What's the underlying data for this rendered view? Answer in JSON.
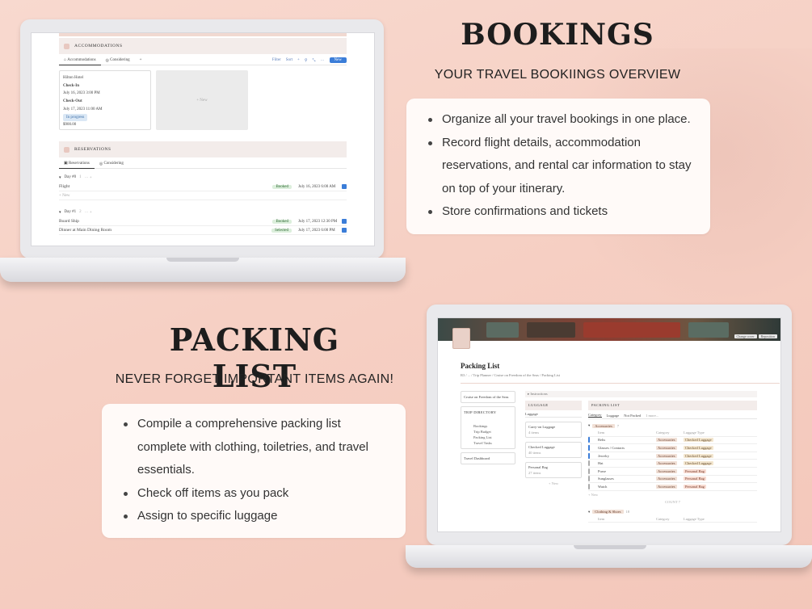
{
  "bookings": {
    "title": "BOOKINGS",
    "subtitle": "YOUR TRAVEL BOOKIINGS OVERVIEW",
    "bullets": [
      "Organize all your travel bookings in one place.",
      "Record flight details, accommodation",
      "reservations, and rental car information to stay",
      "on top of your itinerary.",
      "Store confirmations and tickets"
    ]
  },
  "packing": {
    "title": "PACKING LIST",
    "subtitle": "NEVER FORGET IMPORTANT ITEMS AGAIN!",
    "bullets": [
      "Compile a comprehensive packing list",
      "complete with clothing, toiletries, and travel",
      "essentials.",
      "Check off items as you pack",
      "Assign to specific luggage"
    ]
  },
  "screen1": {
    "accommodations": "ACCOMMODATIONS",
    "tabs": [
      "Accommodations",
      "Considering",
      "+"
    ],
    "tools": [
      "Filter",
      "Sort",
      "+",
      "⚲",
      "⤡",
      "⋯"
    ],
    "new_button": "New",
    "hotel_card": {
      "name": "Hilton Hotel",
      "checkin_label": "Check-In",
      "checkin": "July 16, 2023 3:00 PM",
      "checkout_label": "Check-Out",
      "checkout": "July 17, 2023 11:00 AM",
      "status": "In progress",
      "price": "$900.00"
    },
    "new_card": "+ New",
    "reservations": "RESERVATIONS",
    "res_tabs": [
      "Reservations",
      "Considering"
    ],
    "day0": {
      "label": "Day #0",
      "count": "1"
    },
    "day0_rows": [
      {
        "name": "Flight",
        "status": "Booked",
        "date": "July 16, 2023 6:00 AM"
      }
    ],
    "new_row": "+ New",
    "day1": {
      "label": "Day #1",
      "count": "2"
    },
    "day1_rows": [
      {
        "name": "Board Ship",
        "status": "Booked",
        "date": "July 17, 2023 12:30 PM"
      },
      {
        "name": "Dinner at Main Dining Room",
        "status": "Selected",
        "date": "July 17, 2023 6:00 PM"
      }
    ]
  },
  "screen2": {
    "banner_buttons": [
      "Change cover",
      "Reposition"
    ],
    "page_title": "Packing List",
    "breadcrumb": "R3 / ... / Trip Planner / Cruise on Freedom of the Seas / Packing List",
    "left": {
      "cruise": "Cruise on Freedom of the Seas",
      "trip_dir": "TRIP DIRECTORY",
      "dir_items": [
        "Bookings",
        "Trip Budget",
        "Packing List",
        "Travel Tasks"
      ],
      "dashboard": "Travel Dashboard"
    },
    "instructions": "Instructions",
    "luggage": {
      "header": "LUGGAGE",
      "tab": "Luggage",
      "items": [
        {
          "name": "Carry-on Luggage",
          "count": "4 items"
        },
        {
          "name": "Checked Luggage",
          "count": "40 items"
        },
        {
          "name": "Personal Bag",
          "count": "27 items"
        }
      ],
      "new": "+ New"
    },
    "packing": {
      "header": "PACKING LIST",
      "tabs": [
        "Category",
        "Luggage",
        "Not Packed",
        "1 more..."
      ],
      "group1": "Accessories",
      "group1_count": "7",
      "columns": [
        "Item",
        "Category",
        "Luggage Type"
      ],
      "rows": [
        {
          "item": "Belts",
          "checked": true,
          "category": "Accessories",
          "luggage": "Checked Luggage"
        },
        {
          "item": "Glasses / Contacts",
          "checked": true,
          "category": "Accessories",
          "luggage": "Checked Luggage"
        },
        {
          "item": "Jewelry",
          "checked": true,
          "category": "Accessories",
          "luggage": "Checked Luggage"
        },
        {
          "item": "Hat",
          "checked": false,
          "category": "Accessories",
          "luggage": "Checked Luggage"
        },
        {
          "item": "Purse",
          "checked": false,
          "category": "Accessories",
          "luggage": "Personal Bag"
        },
        {
          "item": "Sunglasses",
          "checked": false,
          "category": "Accessories",
          "luggage": "Personal Bag"
        },
        {
          "item": "Watch",
          "checked": false,
          "category": "Accessories",
          "luggage": "Personal Bag"
        }
      ],
      "new_row": "+ New",
      "count_label": "COUNT 7",
      "group2": "Clothing & Shoes",
      "group2_count": "18"
    }
  }
}
